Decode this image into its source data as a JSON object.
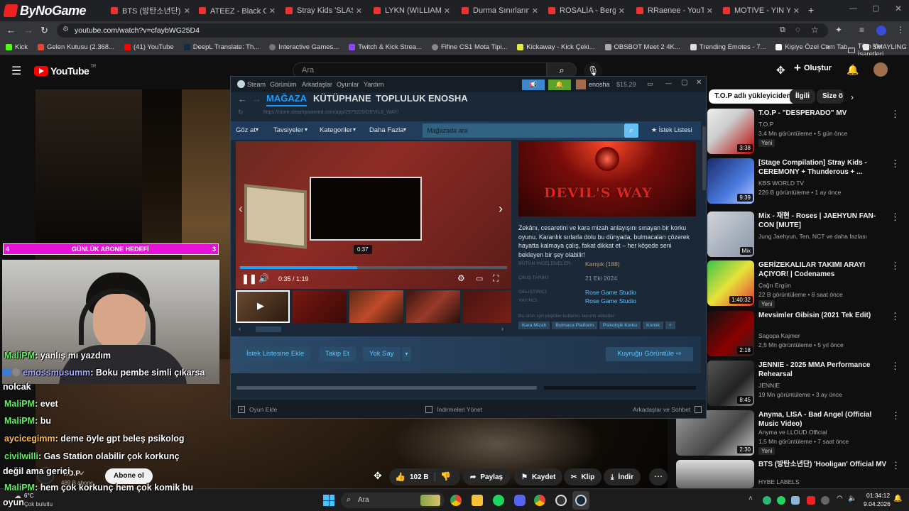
{
  "tabs": [
    {
      "title": "ByNoGame",
      "fav": "#e22"
    },
    {
      "title": "BTS (방탄소년단) - 고",
      "fav": "#e33"
    },
    {
      "title": "ATEEZ - Black Cat(검",
      "fav": "#e33"
    },
    {
      "title": "Stray Kids 'SLASH' Ly",
      "fav": "#e33"
    },
    {
      "title": "LYKN (WILLIAM) - I H",
      "fav": "#e33"
    },
    {
      "title": "Durma Sınırlarını Zor",
      "fav": "#e33"
    },
    {
      "title": "ROSALÍA - Berghain",
      "fav": "#e33"
    },
    {
      "title": "RRaenee - YouTube",
      "fav": "#e33"
    },
    {
      "title": "MOTIVE - YIN YANG",
      "fav": "#e33"
    }
  ],
  "url": "youtube.com/watch?v=cfaybWG25D4",
  "bookmarks": [
    "Kick",
    "Gelen Kutusu (2.368...",
    "(41) YouTube",
    "DeepL Translate: Th...",
    "Interactive Games...",
    "Twitch & Kick Strea...",
    "Fifine CS1 Mota Tipi...",
    "Kickaway - Kick Çeki...",
    "OBSBOT Meet 2 4K...",
    "Trending Emotes - 7...",
    "Kişiye Özel Cam Tab...",
    "SMAYLING LED Vide..."
  ],
  "bookmarks_folder": "Tüm Yer İşaretleri",
  "yt": {
    "logo": "YouTube",
    "logo_sup": "TR",
    "search_placeholder": "Ara",
    "create": "Oluştur",
    "chips": [
      "T.O.P adlı yükleyiciden",
      "İlgili",
      "Size ö"
    ],
    "goal_left": "4",
    "goal_label": "GÜNLÜK ABONE HEDEFİ",
    "goal_right": "3",
    "channel_name": "T.O.P",
    "subs": "489 B abone",
    "subscribe": "Abone ol",
    "likes": "102 B",
    "share": "Paylaş",
    "save": "Kaydet",
    "clip": "Klip",
    "download": "İndir"
  },
  "recs": [
    {
      "title": "T.O.P - \"DESPERADO\" MV",
      "channel": "T.O.P",
      "meta": "3,4 Mn görüntüleme • 5 gün önce",
      "new": "Yeni",
      "dur": "3:38"
    },
    {
      "title": "[Stage Compilation] Stray Kids - CEREMONY + Thunderous + ...",
      "channel": "KBS WORLD TV",
      "meta": "226 B görüntüleme • 1 ay önce",
      "new": "",
      "dur": "9:39"
    },
    {
      "title": "Mix - 재현 - Roses | JAEHYUN FAN-CON [MUTE]",
      "channel": "Jung Jaehyun, Ten, NCT ve daha fazlası",
      "meta": "",
      "new": "",
      "dur": "Mix"
    },
    {
      "title": "GERİZEKALILAR TAKIMI ARAYI AÇIYOR! | Codenames",
      "channel": "Çağrı Ergün",
      "meta": "22 B görüntüleme • 8 saat önce",
      "new": "Yeni",
      "dur": "1:40:32"
    },
    {
      "title": "Mevsimler Gibisin (2021 Tek Edit)",
      "channel": "Sagopa Kajmer",
      "meta": "2,5 Mn görüntüleme • 5 yıl önce",
      "new": "",
      "dur": "2:18"
    },
    {
      "title": "JENNIE - 2025 MMA Performance Rehearsal",
      "channel": "JENNIE",
      "meta": "19 Mn görüntüleme • 3 ay önce",
      "new": "",
      "dur": "8:45"
    },
    {
      "title": "Anyma, LISA - Bad Angel (Official Music Video)",
      "channel": "Anyma ve LLOUD Official",
      "meta": "1,5 Mn görüntüleme • 7 saat önce",
      "new": "Yeni",
      "dur": "2:30"
    },
    {
      "title": "BTS (방탄소년단) 'Hooligan' Official MV",
      "channel": "HYBE LABELS",
      "meta": "",
      "new": "",
      "dur": ""
    }
  ],
  "chat": [
    {
      "user": "MaliPM",
      "msg": ": yanlış mı yazdım",
      "color": "#66ee66"
    },
    {
      "user": "emossmusumm",
      "msg": ": Boku pembe simli çıkarsa",
      "color": "#aaaaff"
    },
    {
      "user": "",
      "msg": "nolcak",
      "color": "#ffffff"
    },
    {
      "user": "MaliPM",
      "msg": ": evet",
      "color": "#66ee66"
    },
    {
      "user": "MaliPM",
      "msg": ": bu",
      "color": "#66ee66"
    },
    {
      "user": "aycicegimm",
      "msg": ": deme öyle gpt beleş psikolog",
      "color": "#ffbb44"
    },
    {
      "user": "civilwilli",
      "msg": ": Gas Station olabilir çok korkunç",
      "color": "#66ee66"
    },
    {
      "user": "",
      "msg": "değil ama gerici",
      "color": "#ffffff"
    },
    {
      "user": "MaliPM",
      "msg": ": hem çok korkunç hem çok komik bu",
      "color": "#66ee66"
    },
    {
      "user": "",
      "msg": "oyun",
      "color": "#ffffff"
    }
  ],
  "steam": {
    "menu": [
      "Steam",
      "Görünüm",
      "Arkadaşlar",
      "Oyunlar",
      "Yardım"
    ],
    "user": "enosha",
    "balance": "$15.29",
    "nav": [
      "MAĞAZA",
      "KÜTÜPHANE",
      "TOPLULUK",
      "ENOSHA"
    ],
    "url": "https://store.steampowered.com/app/2979220/DEVILS_WAY/",
    "store_nav": [
      "Göz at",
      "Tavsiyeler",
      "Kategoriler",
      "Daha Fazla"
    ],
    "search_placeholder": "Mağazada ara",
    "wishlist": "İstek Listesi",
    "time": "0:35 / 1:19",
    "hover_time": "0:37",
    "progress": 0.44,
    "capsule_title": "DEVIL'S WAY",
    "desc": "Zekânı, cesaretini ve kara mizah anlayışını sınayan bir korku oyunu. Karanlık sırlarla dolu bu dünyada, bulmacaları çözerek hayatta kalmaya çalış, fakat dikkat et – her köşede seni bekleyen bir şey olabilir!",
    "reviews_label": "BÜTÜN İNCELEMELER:",
    "reviews_val": "Karışık (188)",
    "date_label": "ÇIKIŞ TARİHİ:",
    "date_val": "21 Eki 2024",
    "dev_label": "GELİŞTİRİCİ:",
    "dev_val": "Rose Game Studio",
    "pub_label": "YAYINCI:",
    "pub_val": "Rose Game Studio",
    "tags_label": "Bu ürün için popüler kullanıcı tanımlı etiketler:",
    "tags": [
      "Kara Mizah",
      "Bulmaca Platform",
      "Psikolojik Korku",
      "Komik",
      "+"
    ],
    "btn_wishlist": "İstek Listesine Ekle",
    "btn_follow": "Takip Et",
    "btn_ignore": "Yok Say",
    "btn_queue": "Kuyruğu Görüntüle",
    "footer_add": "Oyun Ekle",
    "footer_dl": "İndirmeleri Yönet",
    "footer_friends": "Arkadaşlar ve Sohbet"
  },
  "taskbar": {
    "weather_temp": "6°C",
    "weather_desc": "Çok bulutlu",
    "search": "Ara",
    "time": "01:34:12",
    "date": "9.04.2026"
  }
}
